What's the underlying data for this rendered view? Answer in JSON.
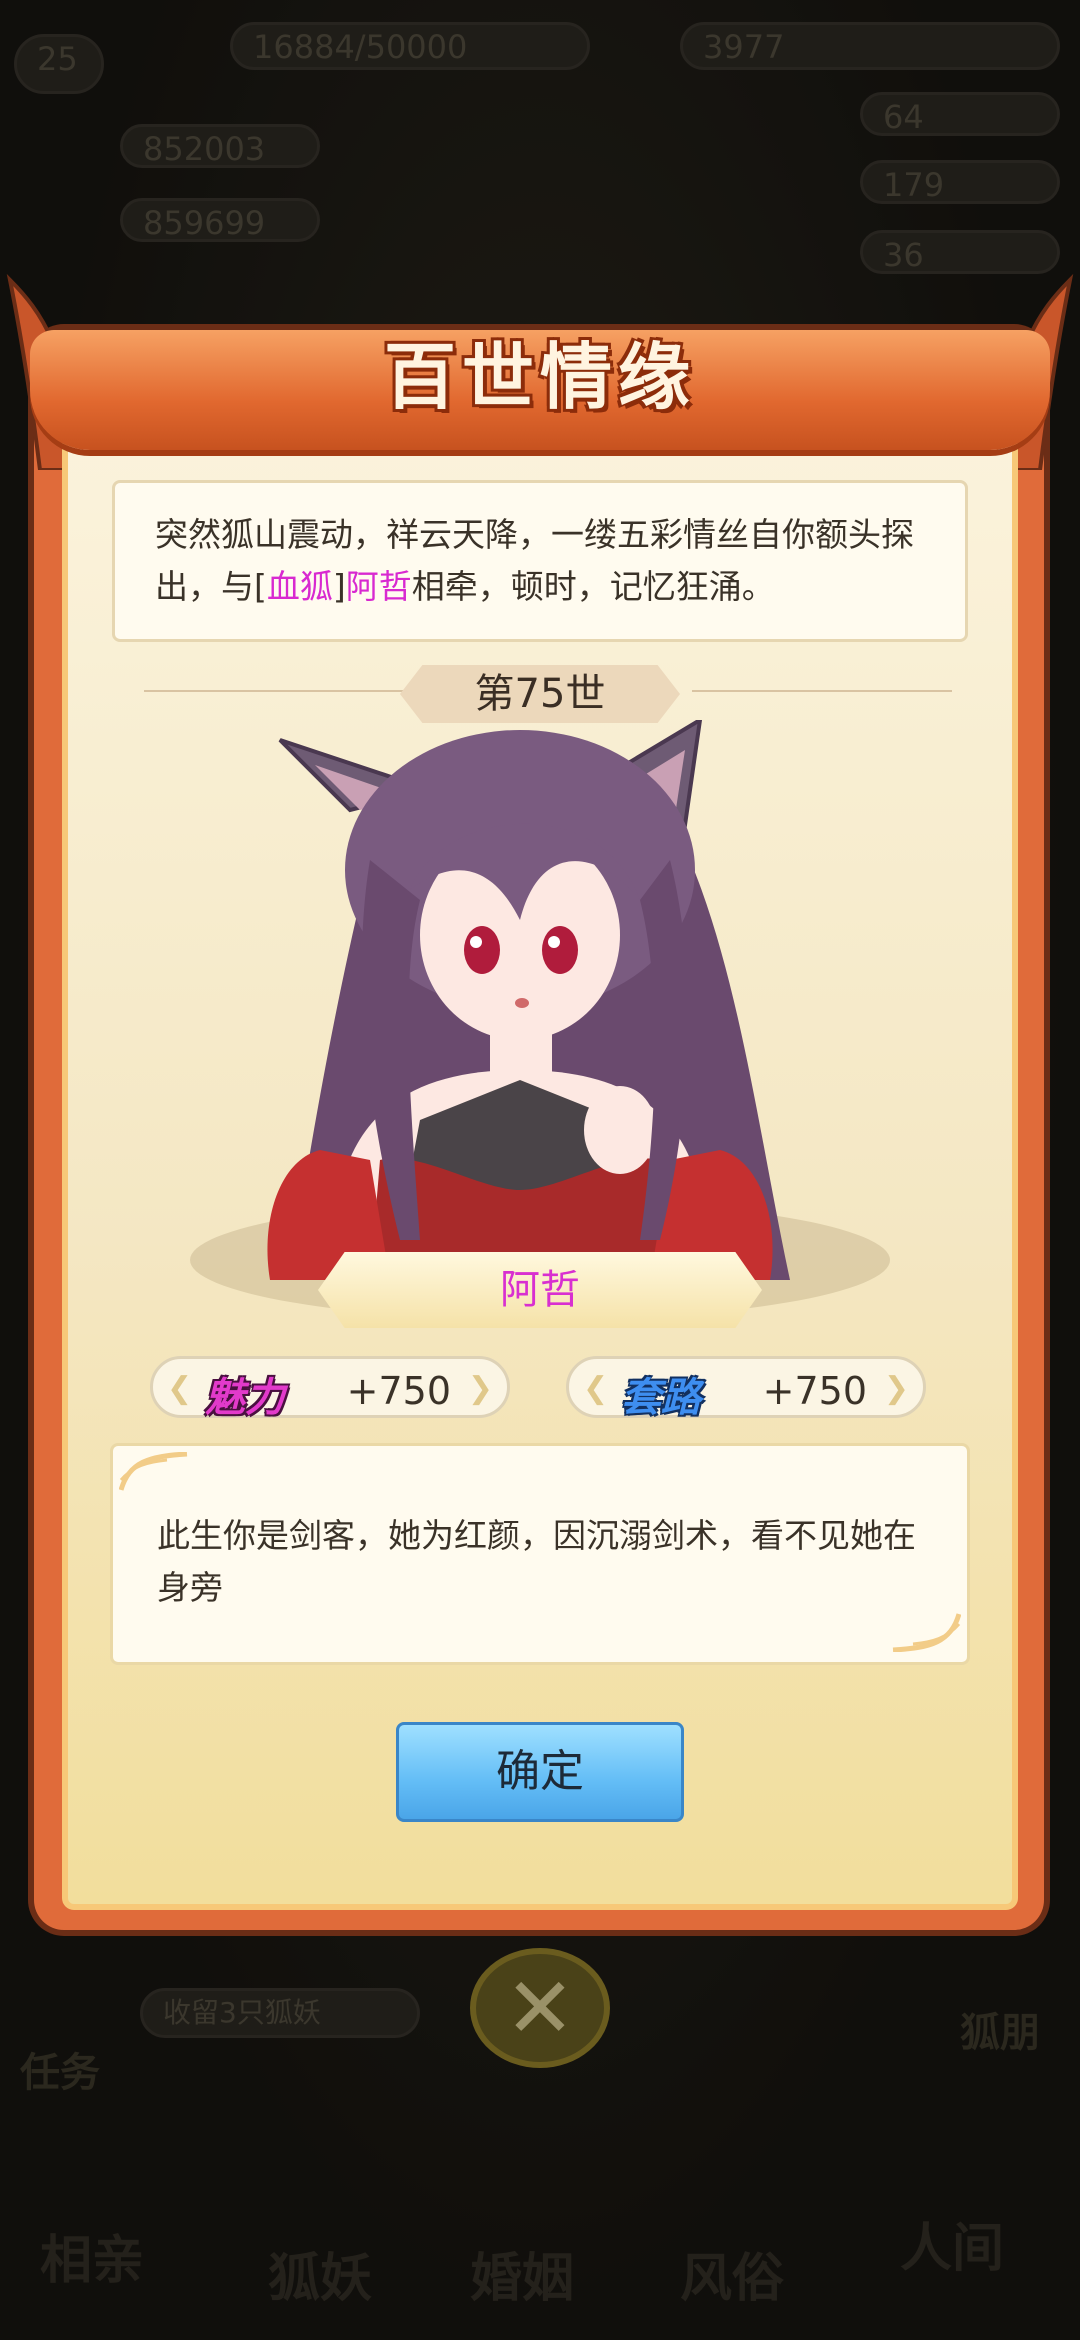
{
  "background": {
    "level_badge": "25",
    "exp_text": "16884/50000",
    "stat_pills": [
      "852003",
      "859699"
    ],
    "currency_top": "3977",
    "side_counts": [
      "64",
      "179",
      "36"
    ],
    "task_text": "收留3只狐妖",
    "bottom_nav": [
      "相亲",
      "狐妖",
      "婚姻",
      "风俗",
      "人间"
    ],
    "side_labels": [
      "任务",
      "狐朋"
    ]
  },
  "dialog": {
    "title": "百世情缘",
    "story": {
      "part1": "突然狐山震动，祥云天降，一缕五彩情丝自你额头探出，与[",
      "clan": "血狐",
      "part2": "]",
      "name": "阿哲",
      "part3": "相牵，顿时，记忆狂涌。"
    },
    "generation": "第75世",
    "character_name": "阿哲",
    "stats": [
      {
        "label": "魅力",
        "value": "+750"
      },
      {
        "label": "套路",
        "value": "+750"
      }
    ],
    "description": "此生你是剑客，她为红颜，因沉溺剑术，看不见她在身旁",
    "confirm_label": "确定"
  },
  "colors": {
    "accent_magenta": "#d829d0",
    "frame_orange": "#e06b3a",
    "button_blue": "#63bdf6"
  }
}
